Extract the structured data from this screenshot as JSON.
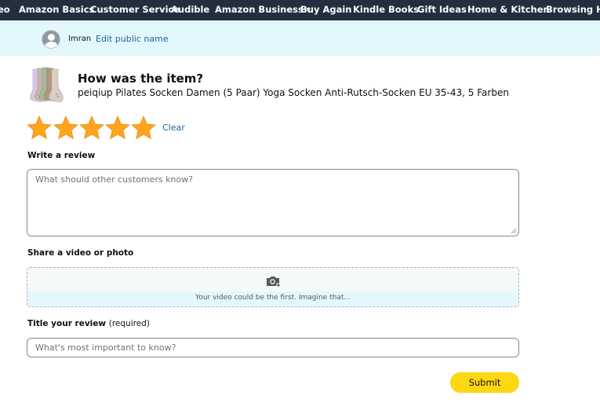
{
  "nav": {
    "items": [
      {
        "label": "eo"
      },
      {
        "label": "Amazon Basics"
      },
      {
        "label": "Customer Service"
      },
      {
        "label": "Audible"
      },
      {
        "label": "Amazon Business"
      },
      {
        "label": "Buy Again"
      },
      {
        "label": "Kindle Books"
      },
      {
        "label": "Gift Ideas"
      },
      {
        "label": "Home & Kitchen"
      },
      {
        "label": "Browsing Hist"
      }
    ]
  },
  "profile": {
    "name": "Imran",
    "edit_label": "Edit public name"
  },
  "product": {
    "question": "How was the item?",
    "name": "peiqiup Pilates Socken Damen (5 Paar) Yoga Socken Anti-Rutsch-Socken EU 35-43, 5 Farben"
  },
  "rating": {
    "value": 5,
    "max": 5,
    "clear_label": "Clear",
    "star_color": "#ffa41c"
  },
  "review": {
    "label": "Write a review",
    "placeholder": "What should other customers know?"
  },
  "media": {
    "label": "Share a video or photo",
    "prompt": "Your video could be the first. Imagine that...",
    "icon": "camera-add-icon"
  },
  "title_field": {
    "label": "Title your review",
    "required_note": "(required)",
    "placeholder": "What's most important to know?"
  },
  "submit_label": "Submit",
  "colors": {
    "nav_bg": "#232f3e",
    "profile_bg": "#e3f8fc",
    "link": "#2162a1",
    "submit_bg": "#ffd814"
  }
}
